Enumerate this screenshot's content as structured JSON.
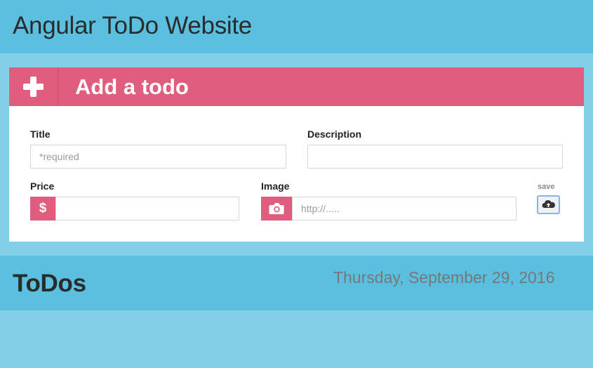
{
  "header": {
    "title": "Angular ToDo Website"
  },
  "add_panel": {
    "title": "Add a todo",
    "icon": "plus-icon",
    "title_field": {
      "label": "Title",
      "placeholder": "*required",
      "value": ""
    },
    "description_field": {
      "label": "Description",
      "placeholder": "",
      "value": ""
    },
    "price_field": {
      "label": "Price",
      "addon_symbol": "$",
      "placeholder": "",
      "value": ""
    },
    "image_field": {
      "label": "Image",
      "addon_icon": "camera-icon",
      "placeholder": "http://.....",
      "value": ""
    },
    "save": {
      "label": "save",
      "icon": "cloud-upload-icon"
    }
  },
  "todos": {
    "title": "ToDos",
    "date": "Thursday, September 29, 2016"
  },
  "colors": {
    "background": "#83cfe7",
    "header": "#5bbfdf",
    "accent": "#e05d7d",
    "panel": "#ffffff"
  }
}
